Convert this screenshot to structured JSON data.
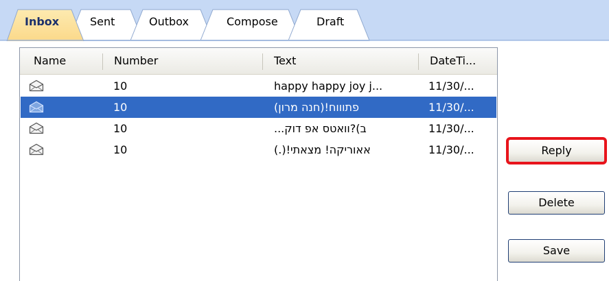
{
  "tabs": [
    {
      "label": "Inbox",
      "active": true
    },
    {
      "label": "Sent",
      "active": false
    },
    {
      "label": "Outbox",
      "active": false
    },
    {
      "label": "Compose",
      "active": false
    },
    {
      "label": "Draft",
      "active": false
    }
  ],
  "list": {
    "columns": [
      "Name",
      "Number",
      "Text",
      "DateTi..."
    ],
    "rows": [
      {
        "icon": "envelope-icon",
        "number": "10",
        "text": "happy happy joy j...",
        "date": "11/30/...",
        "selected": false
      },
      {
        "icon": "envelope-icon",
        "number": "10",
        "text": "(חנה מרון)!פתוווח",
        "date": "11/30/...",
        "selected": true
      },
      {
        "icon": "envelope-icon",
        "number": "10",
        "text": "...ב)?וואטס אפ דוק",
        "date": "11/30/...",
        "selected": false
      },
      {
        "icon": "envelope-icon",
        "number": "10",
        "text": "(.)!אאוריקה! מצאתי",
        "date": "11/30/...",
        "selected": false
      }
    ]
  },
  "buttons": {
    "reply": "Reply",
    "delete": "Delete",
    "save": "Save"
  },
  "colors": {
    "selection": "#316ac5",
    "highlight": "#e8141b",
    "tab_strip": "#c6d9f5"
  }
}
